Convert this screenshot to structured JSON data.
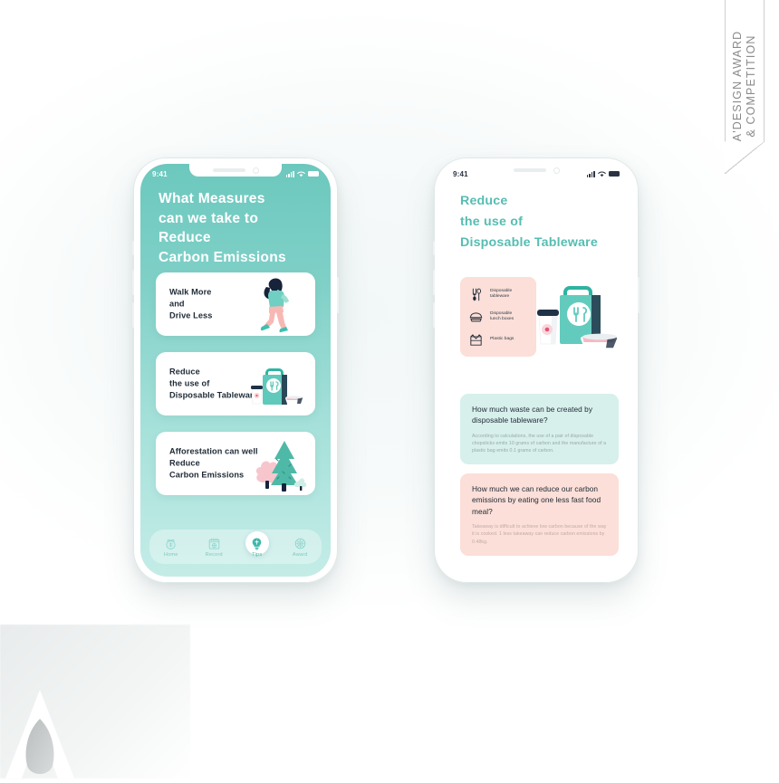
{
  "award_ribbon": {
    "line1": "A'DESIGN AWARD",
    "line2": "& COMPETITION"
  },
  "colors": {
    "teal_dark": "#56bdb2",
    "teal_header": "#6cc8be",
    "teal_light": "#c4ece7",
    "card_teal": "#d7f0ec",
    "card_pink": "#fbdfd8",
    "text_dark": "#222b36",
    "text_muted": "#9aa8a8"
  },
  "phone_one": {
    "status_bar": {
      "time": "9:41",
      "signal_icon": "signal-bars-icon",
      "wifi_icon": "wifi-icon",
      "battery_icon": "battery-icon"
    },
    "title": "What Measures\ncan we take to\nReduce\nCarbon Emissions",
    "cards": [
      {
        "text": "Walk More\nand\nDrive Less",
        "art": "walking-woman-illustration"
      },
      {
        "text": "Reduce\nthe use of\nDisposable Tableware",
        "art": "takeaway-bag-illustration"
      },
      {
        "text": "Afforestation can well\nReduce\nCarbon Emissions",
        "art": "trees-illustration"
      }
    ],
    "tabbar": [
      {
        "label": "Home",
        "icon": "home-icon",
        "active": false
      },
      {
        "label": "Record",
        "icon": "calendar-record-icon",
        "active": false
      },
      {
        "label": "Tips",
        "icon": "lightbulb-tips-icon",
        "active": true
      },
      {
        "label": "Award",
        "icon": "medal-award-icon",
        "active": false
      }
    ]
  },
  "phone_two": {
    "status_bar": {
      "time": "9:41",
      "signal_icon": "signal-bars-icon",
      "wifi_icon": "wifi-icon",
      "battery_icon": "battery-icon"
    },
    "title": "Reduce\nthe use of\nDisposable Tableware",
    "items_panel": [
      {
        "label": "Disposable\ntableware",
        "icon": "cutlery-icon"
      },
      {
        "label": "Disposable\nlunch boxes",
        "icon": "lunchbox-icon"
      },
      {
        "label": "Plastic bags",
        "icon": "plastic-bag-icon"
      }
    ],
    "hero_art": "takeaway-bag-cup-bowl-illustration",
    "question_cards": [
      {
        "title": "How much waste can be created by disposable tableware?",
        "body": "According to calculations, the use of a pair of disposable chopsticks emits 10 grams of carbon and the manufacture of a plastic bag emits 0.1 grams of carbon."
      },
      {
        "title": "How much we can reduce our carbon emissions by eating one less fast food meal?",
        "body": "Takeaway is difficult to achieve low carbon because of the way it is cooked. 1 less takeaway can reduce carbon emissions by 0.48kg."
      }
    ]
  }
}
